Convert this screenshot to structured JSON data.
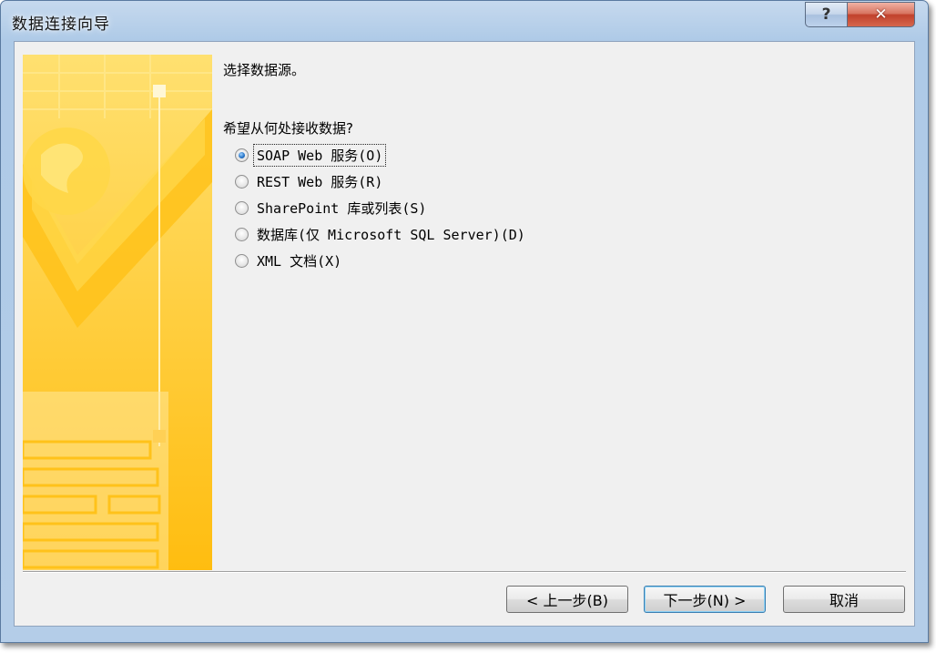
{
  "window": {
    "title": "数据连接向导",
    "help_label": "?",
    "close_label": "✕"
  },
  "wizard": {
    "heading": "选择数据源。",
    "question": "希望从何处接收数据?",
    "options": [
      {
        "label": "SOAP Web 服务(O)",
        "checked": true
      },
      {
        "label": "REST Web 服务(R)",
        "checked": false
      },
      {
        "label": "SharePoint 库或列表(S)",
        "checked": false
      },
      {
        "label": "数据库(仅 Microsoft SQL Server)(D)",
        "checked": false
      },
      {
        "label": "XML 文档(X)",
        "checked": false
      }
    ]
  },
  "buttons": {
    "back": "< 上一步(B)",
    "next": "下一步(N) >",
    "cancel": "取消"
  }
}
